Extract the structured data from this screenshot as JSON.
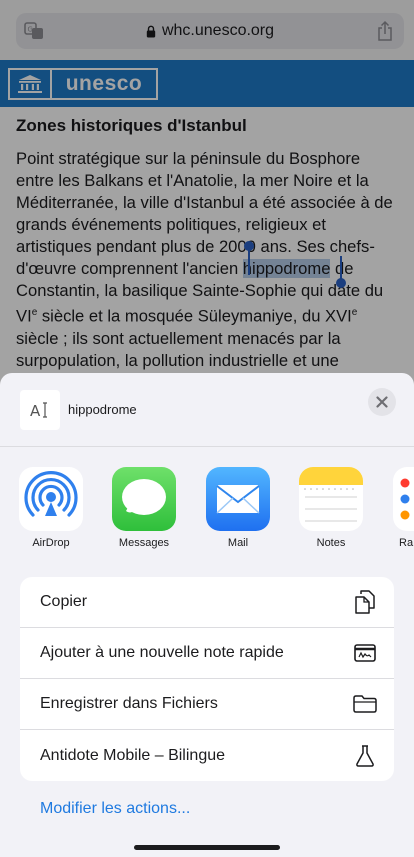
{
  "browser": {
    "url": "whc.unesco.org"
  },
  "banner": {
    "logo_text": "unesco"
  },
  "article": {
    "title": "Zones historiques d'Istanbul",
    "text_before_selection": "Point stratégique sur la péninsule du Bosphore entre les Balkans et l'Anatolie, la mer Noire et la Méditerranée, la ville d'Istanbul a été associée à de grands événements politiques, religieux et artistiques pendant plus de 2000 ans. Ses chefs-d'œuvre comprennent l'ancien ",
    "selected_word": "hippodrome",
    "text_after_selection_1": " de Constantin, la basilique Sainte-Sophie qui date du VI",
    "sup_1": "e",
    "text_after_selection_2": " siècle et la mosquée Süleymaniye, du XVI",
    "sup_2": "e",
    "text_after_selection_3": " siècle ; ils sont actuellement menacés par la surpopulation, la pollution industrielle et une urbanisation incontrôlée."
  },
  "share_sheet": {
    "item_title": "hippodrome",
    "apps": [
      {
        "label": "AirDrop",
        "icon": "airdrop-icon"
      },
      {
        "label": "Messages",
        "icon": "messages-icon"
      },
      {
        "label": "Mail",
        "icon": "mail-icon"
      },
      {
        "label": "Notes",
        "icon": "notes-icon"
      },
      {
        "label": "Ra",
        "icon": "reminders-icon"
      }
    ],
    "actions": [
      {
        "label": "Copier",
        "icon": "copy-icon"
      },
      {
        "label": "Ajouter à une nouvelle note rapide",
        "icon": "quick-note-icon"
      },
      {
        "label": "Enregistrer dans Fichiers",
        "icon": "folder-icon"
      },
      {
        "label": "Antidote Mobile – Bilingue",
        "icon": "flask-icon"
      }
    ],
    "edit_actions_label": "Modifier les actions..."
  },
  "colors": {
    "accent": "#1f7ae0",
    "banner": "#1f7ac8",
    "selection": "#b6cdea"
  }
}
